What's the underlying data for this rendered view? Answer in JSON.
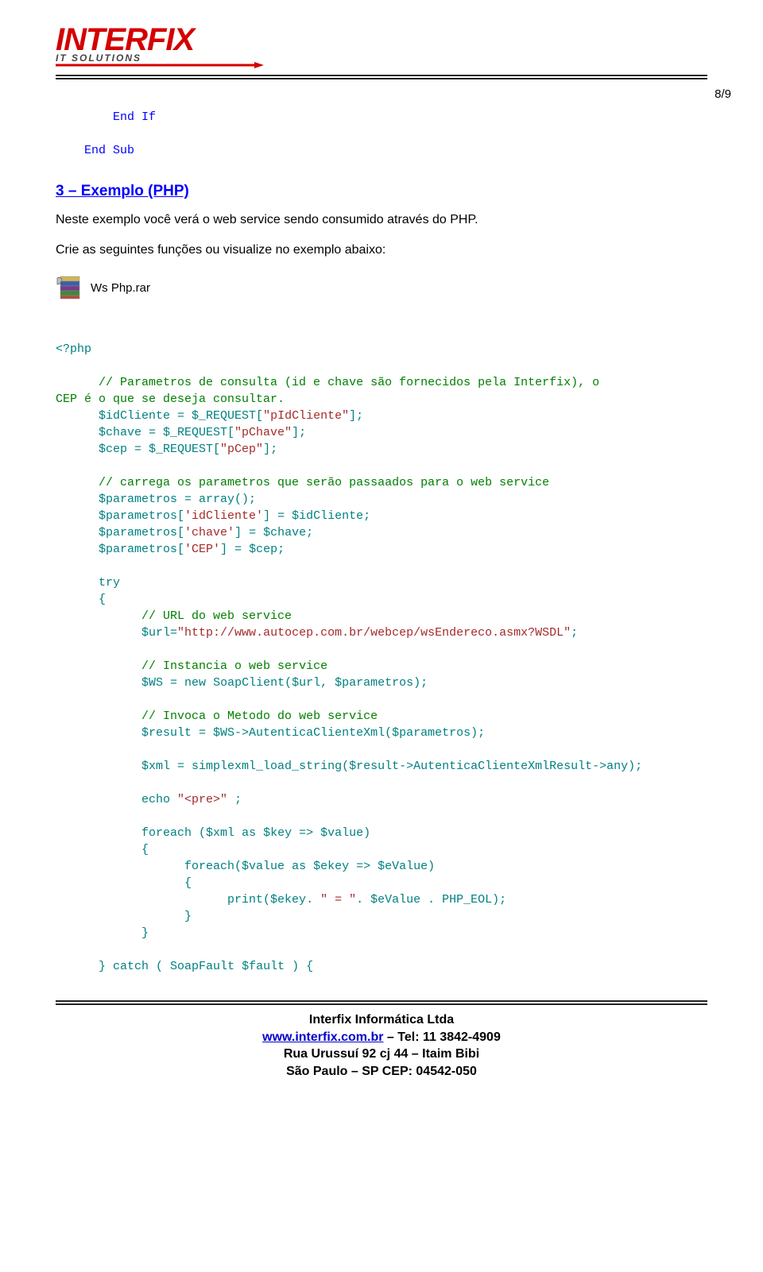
{
  "logo": {
    "main": "INTERFIX",
    "sub": "IT  SOLUTIONS"
  },
  "page_number": "8/9",
  "code_top": {
    "line1": "End If",
    "line2": "End Sub"
  },
  "section": {
    "title": "3 – Exemplo (PHP)",
    "intro": "Neste exemplo você verá o web service sendo consumido através do PHP.",
    "instr": "Crie as seguintes funções ou visualize no exemplo abaixo:"
  },
  "file": {
    "label": "Ws Php.rar"
  },
  "php": {
    "open": "<?php",
    "c1": "// Parametros de consulta (id e chave são fornecidos pela Interfix), o CEP é o que se deseja consultar.",
    "l1": "$idCliente = $_REQUEST[",
    "s1": "\"pIdCliente\"",
    "l1b": "];",
    "l2": "$chave = $_REQUEST[",
    "s2": "\"pChave\"",
    "l2b": "];",
    "l3": "$cep = $_REQUEST[",
    "s3": "\"pCep\"",
    "l3b": "];",
    "c2": "// carrega os parametros que serão passaados para o web service",
    "l4": "$parametros = array();",
    "l5a": "$parametros[",
    "l5s": "'idCliente'",
    "l5b": "] = $idCliente;",
    "l6a": "$parametros[",
    "l6s": "'chave'",
    "l6b": "] = $chave;",
    "l7a": "$parametros[",
    "l7s": "'CEP'",
    "l7b": "] = $cep;",
    "try": "try",
    "brace_open": "{",
    "c3": "// URL do web service",
    "l8a": "$url=",
    "l8s": "\"http://www.autocep.com.br/webcep/wsEndereco.asmx?WSDL\"",
    "l8b": ";",
    "c4": "// Instancia o web service",
    "l9a": "$WS = ",
    "l9new": "new",
    "l9b": " SoapClient($url, $parametros);",
    "c5": "// Invoca o Metodo do web service",
    "l10": "$result = $WS->AutenticaClienteXml($parametros);",
    "l11": "$xml = simplexml_load_string($result->AutenticaClienteXmlResult->any);",
    "l12a": "echo ",
    "l12s": "\"<pre>\"",
    "l12b": " ;",
    "l13a": "foreach",
    "l13b": " ($xml ",
    "l13as": "as",
    "l13c": " $key => $value)",
    "l14": "{",
    "l15a": "foreach",
    "l15b": "($value ",
    "l15as": "as",
    "l15c": " $ekey => $eValue)",
    "l16": "{",
    "l17a": "print($ekey. ",
    "l17s": "\" = \"",
    "l17b": ". $eValue . PHP_EOL);",
    "l18": "}",
    "l19": "}",
    "l20a": "} ",
    "l20catch": "catch",
    "l20b": " ( SoapFault $fault ) {"
  },
  "footer": {
    "company": "Interfix Informática Ltda",
    "site": "www.interfix.com.br",
    "tel_label": " – Tel: 11 3842-4909",
    "addr1": "Rua Urussuí 92 cj 44 – Itaim Bibi",
    "addr2": "São Paulo – SP CEP: 04542-050"
  }
}
